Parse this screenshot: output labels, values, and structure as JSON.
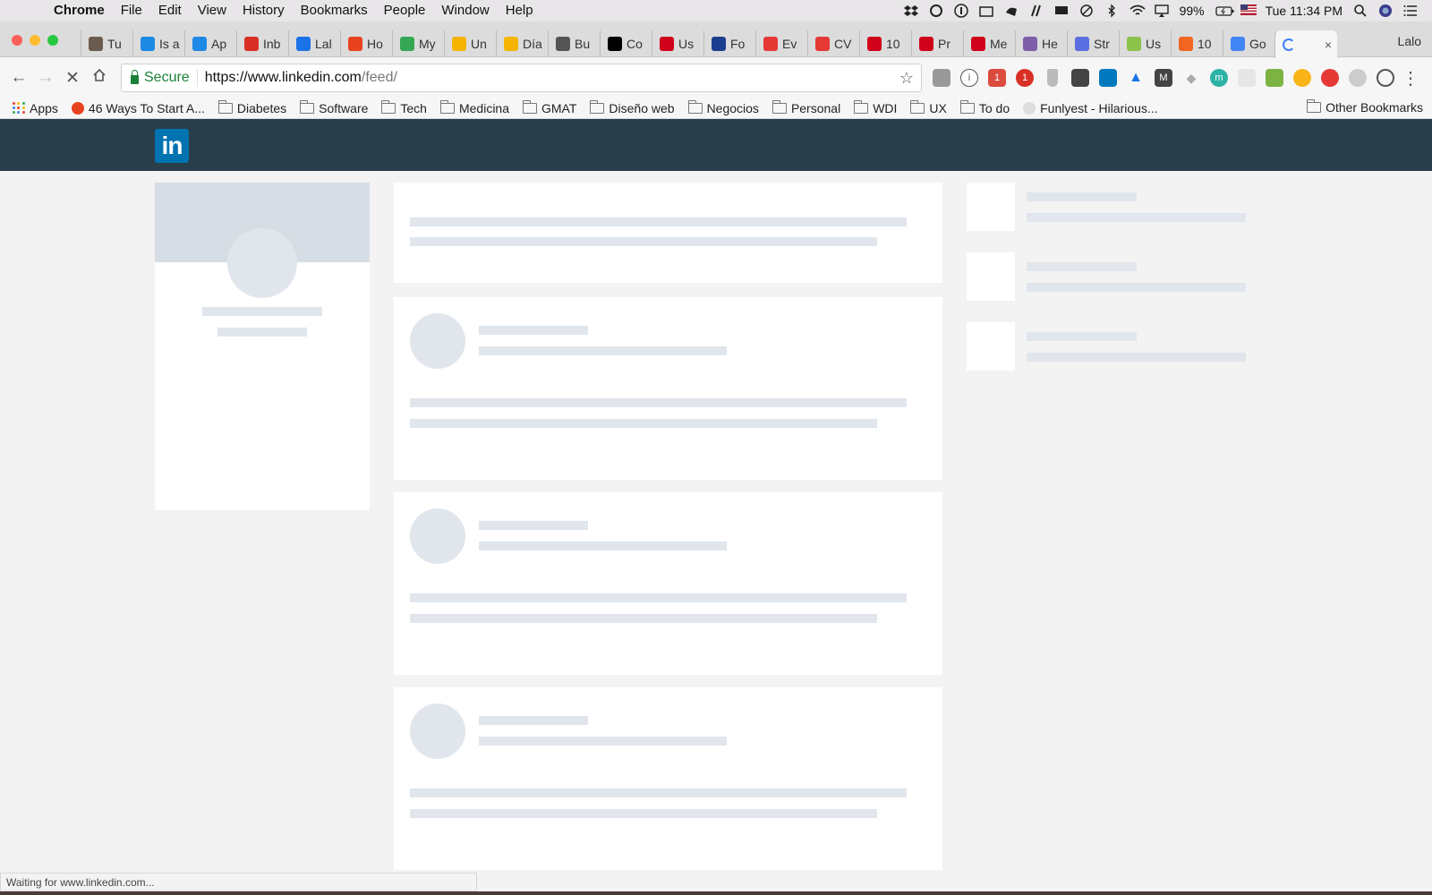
{
  "menubar": {
    "app": "Chrome",
    "items": [
      "File",
      "Edit",
      "View",
      "History",
      "Bookmarks",
      "People",
      "Window",
      "Help"
    ],
    "battery": "99%",
    "clock": "Tue 11:34 PM"
  },
  "tabs": [
    {
      "label": "Tu",
      "color": "#6b5b4e"
    },
    {
      "label": "Is a",
      "color": "#1e88e5"
    },
    {
      "label": "Ap",
      "color": "#1e88e5"
    },
    {
      "label": "Inb",
      "color": "#d93025"
    },
    {
      "label": "Lal",
      "color": "#1a73e8"
    },
    {
      "label": "Ho",
      "color": "#e8431f"
    },
    {
      "label": "My",
      "color": "#34a853"
    },
    {
      "label": "Un",
      "color": "#f4b400"
    },
    {
      "label": "Día",
      "color": "#f4b400"
    },
    {
      "label": "Bu",
      "color": "#555555"
    },
    {
      "label": "Co",
      "color": "#000000"
    },
    {
      "label": "Us",
      "color": "#d0021b"
    },
    {
      "label": "Fo",
      "color": "#1a3d8f"
    },
    {
      "label": "Ev",
      "color": "#e53935"
    },
    {
      "label": "CV",
      "color": "#e53935"
    },
    {
      "label": "10",
      "color": "#d0021b"
    },
    {
      "label": "Pr",
      "color": "#d0021b"
    },
    {
      "label": "Me",
      "color": "#d0021b"
    },
    {
      "label": "He",
      "color": "#7b5ea7"
    },
    {
      "label": "Str",
      "color": "#5b6ee1"
    },
    {
      "label": "Us",
      "color": "#8bc34a"
    },
    {
      "label": "10",
      "color": "#f26522"
    },
    {
      "label": "Go",
      "color": "#4285f4"
    }
  ],
  "active_tab": {
    "close": "×"
  },
  "profile_name": "Lalo",
  "toolbar": {
    "secure_label": "Secure",
    "url_host": "https://www.linkedin.com",
    "url_path": "/feed/"
  },
  "bookmarks": [
    {
      "label": "Apps",
      "type": "apps"
    },
    {
      "label": "46 Ways To Start A...",
      "type": "site"
    },
    {
      "label": "Diabetes",
      "type": "folder"
    },
    {
      "label": "Software",
      "type": "folder"
    },
    {
      "label": "Tech",
      "type": "folder"
    },
    {
      "label": "Medicina",
      "type": "folder"
    },
    {
      "label": "GMAT",
      "type": "folder"
    },
    {
      "label": "Diseño web",
      "type": "folder"
    },
    {
      "label": "Negocios",
      "type": "folder"
    },
    {
      "label": "Personal",
      "type": "folder"
    },
    {
      "label": "WDI",
      "type": "folder"
    },
    {
      "label": "UX",
      "type": "folder"
    },
    {
      "label": "To do",
      "type": "folder"
    },
    {
      "label": "Funlyest - Hilarious...",
      "type": "site"
    }
  ],
  "other_bookmarks": "Other Bookmarks",
  "linkedin": {
    "logo_text": "in",
    "brand_color": "#0073b1",
    "header_color": "#283e4a"
  },
  "status_text": "Waiting for www.linkedin.com..."
}
